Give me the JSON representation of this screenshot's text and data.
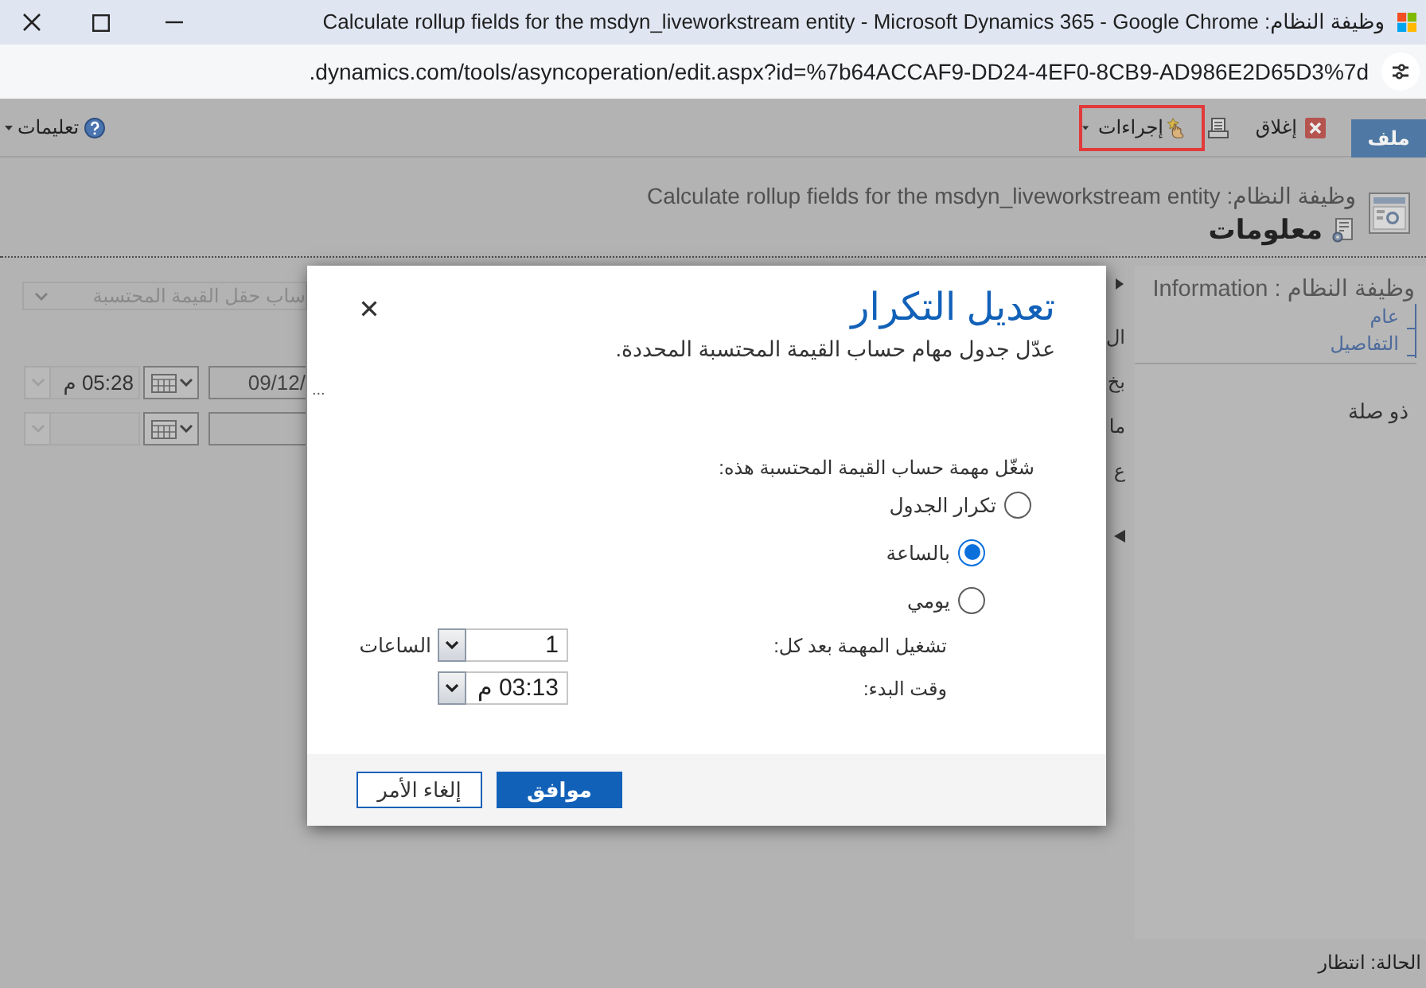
{
  "window": {
    "title": "وظيفة النظام: Calculate rollup fields for the msdyn_liveworkstream entity - Microsoft Dynamics 365 - Google Chrome"
  },
  "address_bar": {
    "url": ".dynamics.com/tools/asyncoperation/edit.aspx?id=%7b64ACCAF9-DD24-4EF0-8CB9-AD986E2D65D3%7d"
  },
  "toolbar": {
    "items": [
      {
        "kind": "tab",
        "label": "ملف",
        "highlighted": false
      },
      {
        "kind": "command",
        "label": "إغلاق",
        "highlighted": false
      },
      {
        "kind": "icon",
        "highlighted": false
      },
      {
        "kind": "menu",
        "label": "إجراءات",
        "highlighted": true
      }
    ],
    "help": {
      "label": "تعليمات"
    }
  },
  "header": {
    "title": "وظيفة النظام: Calculate rollup fields for the msdyn_liveworkstream entity",
    "form_name": "معلومات"
  },
  "form": {
    "lookup": {
      "value": "ساب حقل القيمة المحتسبة",
      "disabled": true
    },
    "datetime_rows": [
      {
        "kind": "datetime",
        "date": "09/12/",
        "time": "05:28 م"
      },
      {
        "kind": "datetime"
      }
    ],
    "labels": [
      "ال",
      "بخ",
      "ما",
      "ع"
    ]
  },
  "dialog": {
    "title": "تعديل التكرار",
    "subtitle": "عدّل جدول مهام حساب القيمة المحتسبة المحددة.",
    "overflow_marker": "...",
    "prompt": "شغّل مهمة حساب القيمة المحتسبة هذه:",
    "options": [
      {
        "label": "تكرار الجدول",
        "selected": false,
        "children": [
          {
            "label": "بالساعة",
            "selected": true
          },
          {
            "label": "يومي",
            "selected": false
          }
        ]
      }
    ],
    "fields": [
      {
        "label": "تشغيل المهمة بعد كل:",
        "value": "1",
        "unit": "الساعات"
      },
      {
        "label": "وقت البدء:",
        "value": "03:13 م"
      }
    ],
    "buttons": [
      {
        "kind": "primary",
        "label": "موافق"
      },
      {
        "kind": "secondary",
        "label": "إلغاء الأمر"
      }
    ]
  },
  "side_panel": {
    "title": "وظيفة النظام : Information",
    "nav": [
      "عام",
      "التفاصيل"
    ],
    "related": "ذو صلة"
  },
  "status_bar": {
    "text": "الحالة: انتظار"
  }
}
